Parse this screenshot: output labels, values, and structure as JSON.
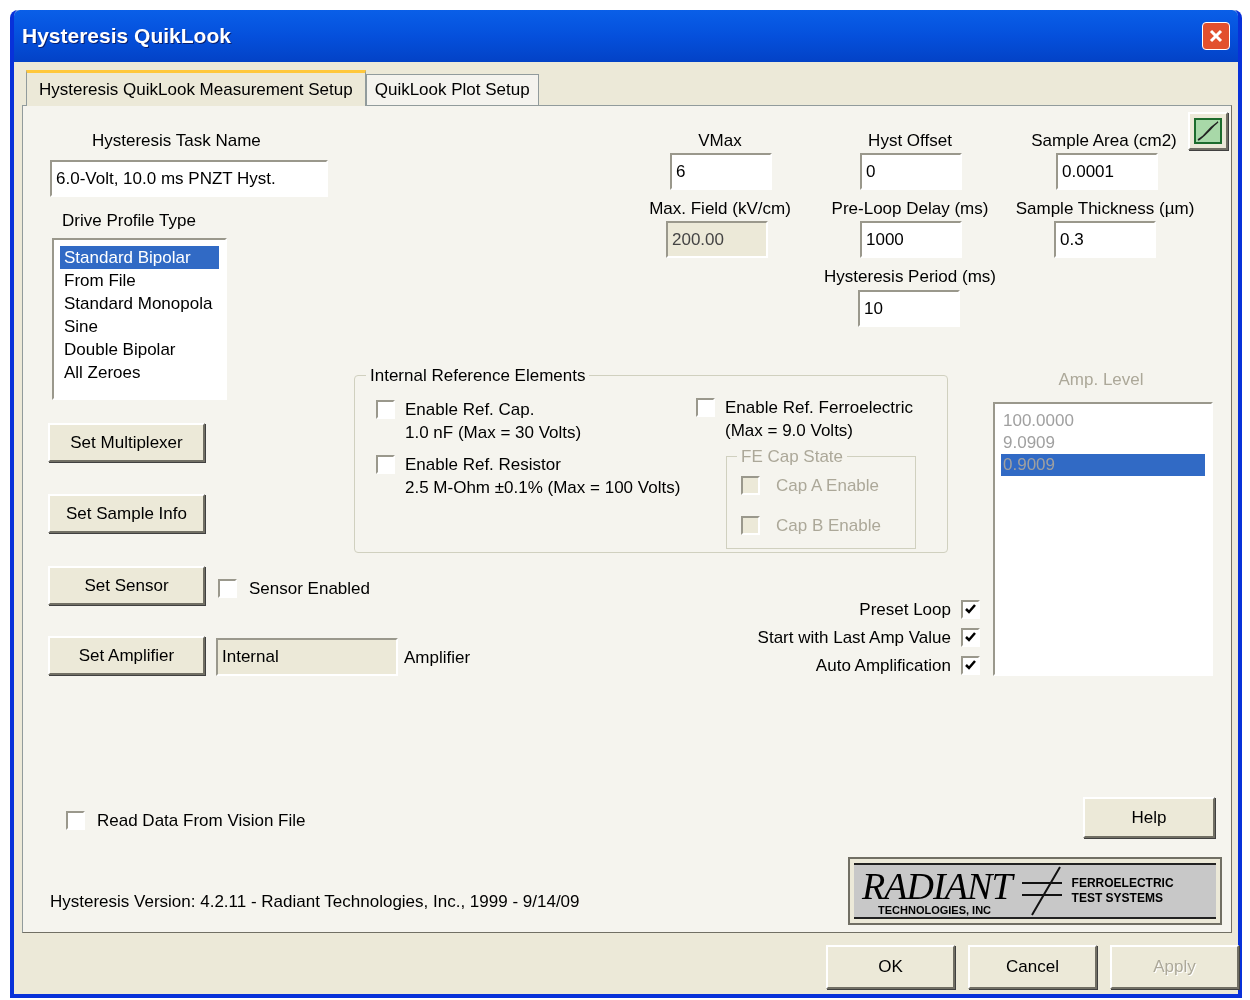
{
  "window": {
    "title": "Hysteresis QuikLook"
  },
  "tabs": [
    {
      "label": "Hysteresis QuikLook Measurement Setup",
      "selected": true
    },
    {
      "label": "QuikLook Plot Setup",
      "selected": false
    }
  ],
  "task_name": {
    "label": "Hysteresis Task Name",
    "value": "6.0-Volt, 10.0 ms PNZT Hyst."
  },
  "drive_profile": {
    "label": "Drive Profile Type",
    "items": [
      {
        "label": "Standard Bipolar",
        "selected": true
      },
      {
        "label": "From File",
        "selected": false
      },
      {
        "label": "Standard Monopola",
        "selected": false
      },
      {
        "label": "Sine",
        "selected": false
      },
      {
        "label": "Double Bipolar",
        "selected": false
      },
      {
        "label": "All Zeroes",
        "selected": false
      }
    ]
  },
  "setup_buttons": [
    "Set Multiplexer",
    "Set Sample Info",
    "Set Sensor",
    "Set Amplifier"
  ],
  "sensor_enabled": {
    "label": "Sensor Enabled",
    "checked": false
  },
  "amplifier": {
    "value": "Internal",
    "label": "Amplifier"
  },
  "fields": [
    {
      "label": "VMax",
      "value": "6",
      "disabled": false
    },
    {
      "label": "Hyst Offset",
      "value": "0",
      "disabled": false
    },
    {
      "label": "Sample Area (cm2)",
      "value": "0.0001",
      "disabled": false
    },
    {
      "label": "Max. Field (kV/cm)",
      "value": "200.00",
      "disabled": true
    },
    {
      "label": "Pre-Loop Delay (ms)",
      "value": "1000",
      "disabled": false
    },
    {
      "label": "Sample Thickness (µm)",
      "value": "0.3",
      "disabled": false
    },
    {
      "label": "Hysteresis Period (ms)",
      "value": "10",
      "disabled": false
    }
  ],
  "reference_elements": {
    "title": "Internal Reference Elements",
    "options": [
      {
        "label": "Enable Ref. Cap.",
        "detail": "1.0 nF (Max = 30 Volts)",
        "checked": false
      },
      {
        "label": "Enable Ref. Resistor",
        "detail": "2.5 M-Ohm ±0.1% (Max = 100 Volts)",
        "checked": false
      },
      {
        "label": "Enable Ref. Ferroelectric",
        "detail": "(Max = 9.0 Volts)",
        "checked": false
      }
    ],
    "fe_cap_state": {
      "title": "FE Cap State",
      "disabled": true,
      "options": [
        {
          "label": "Cap A Enable",
          "checked": false
        },
        {
          "label": "Cap B Enable",
          "checked": false
        }
      ]
    }
  },
  "amp_level": {
    "label": "Amp. Level",
    "disabled": true,
    "items": [
      {
        "label": "100.0000",
        "selected": false
      },
      {
        "label": "9.0909",
        "selected": false
      },
      {
        "label": "0.9009",
        "selected": true
      }
    ]
  },
  "loop_options": [
    {
      "label": "Preset Loop",
      "checked": true
    },
    {
      "label": "Start with Last Amp Value",
      "checked": true
    },
    {
      "label": "Auto Amplification",
      "checked": true
    }
  ],
  "read_vision_file": {
    "label": "Read Data From Vision File",
    "checked": false
  },
  "help_button": "Help",
  "version": "Hysteresis Version: 4.2.11 - Radiant Technologies, Inc., 1999 - 9/14/09",
  "logo": {
    "name": "RADIANT",
    "subtitle": "TECHNOLOGIES, INC",
    "tagline": [
      "FERROELECTRIC",
      "TEST SYSTEMS"
    ]
  },
  "footer_buttons": [
    {
      "label": "OK",
      "disabled": false
    },
    {
      "label": "Cancel",
      "disabled": false
    },
    {
      "label": "Apply",
      "disabled": true
    }
  ]
}
